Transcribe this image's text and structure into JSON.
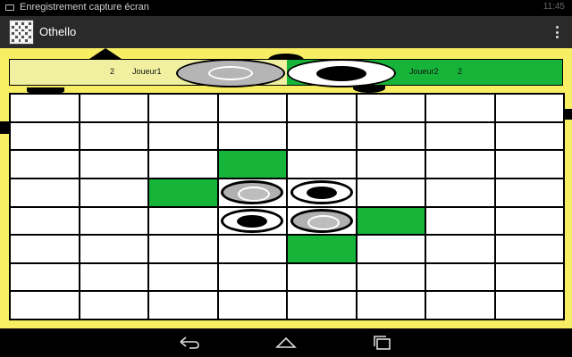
{
  "status_bar": {
    "notification": "Enregistrement capture écran",
    "clock": "11:45"
  },
  "app": {
    "title": "Othello",
    "icon": "othello-board-icon",
    "overflow_icon": "overflow-menu-icon"
  },
  "score": {
    "player1_name": "Joueur1",
    "player1_score": "2",
    "player1_disc": "gray",
    "player2_name": "Joueur2",
    "player2_score": "2",
    "player2_disc": "black"
  },
  "board": {
    "rows": 8,
    "cols": 8,
    "cells": [
      [
        "",
        "",
        "",
        "",
        "",
        "",
        "",
        ""
      ],
      [
        "",
        "",
        "",
        "",
        "",
        "",
        "",
        ""
      ],
      [
        "",
        "",
        "",
        "hint",
        "",
        "",
        "",
        ""
      ],
      [
        "",
        "",
        "hint",
        "gray",
        "black",
        "",
        "",
        ""
      ],
      [
        "",
        "",
        "",
        "black",
        "gray",
        "hint",
        "",
        ""
      ],
      [
        "",
        "",
        "",
        "",
        "hint",
        "",
        "",
        ""
      ],
      [
        "",
        "",
        "",
        "",
        "",
        "",
        "",
        ""
      ],
      [
        "",
        "",
        "",
        "",
        "",
        "",
        "",
        ""
      ]
    ]
  },
  "colors": {
    "background": "#f7ee63",
    "hint": "#16b53a",
    "player1": "#b0b0b0",
    "player2": "#000000"
  },
  "nav": {
    "back_icon": "back-icon",
    "home_icon": "home-icon",
    "recents_icon": "recent-apps-icon"
  }
}
